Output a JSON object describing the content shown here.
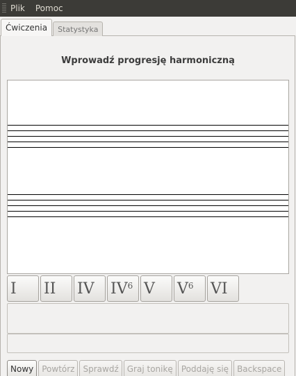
{
  "menu": {
    "items": [
      "Plik",
      "Pomoc"
    ]
  },
  "tabs": [
    {
      "label": "Ćwiczenia",
      "active": true
    },
    {
      "label": "Statystyka",
      "active": false
    }
  ],
  "exercise": {
    "title": "Wprowadź progresję harmoniczną"
  },
  "chords": [
    {
      "numeral": "I",
      "sup": ""
    },
    {
      "numeral": "II",
      "sup": ""
    },
    {
      "numeral": "IV",
      "sup": ""
    },
    {
      "numeral": "IV",
      "sup": "6"
    },
    {
      "numeral": "V",
      "sup": ""
    },
    {
      "numeral": "V",
      "sup": "6"
    },
    {
      "numeral": "VI",
      "sup": ""
    }
  ],
  "buttons": {
    "new": "Nowy",
    "repeat": "Powtórz",
    "check": "Sprawdź",
    "play_tonic": "Graj tonikę",
    "give_up": "Poddaję się",
    "backspace": "Backspace"
  }
}
